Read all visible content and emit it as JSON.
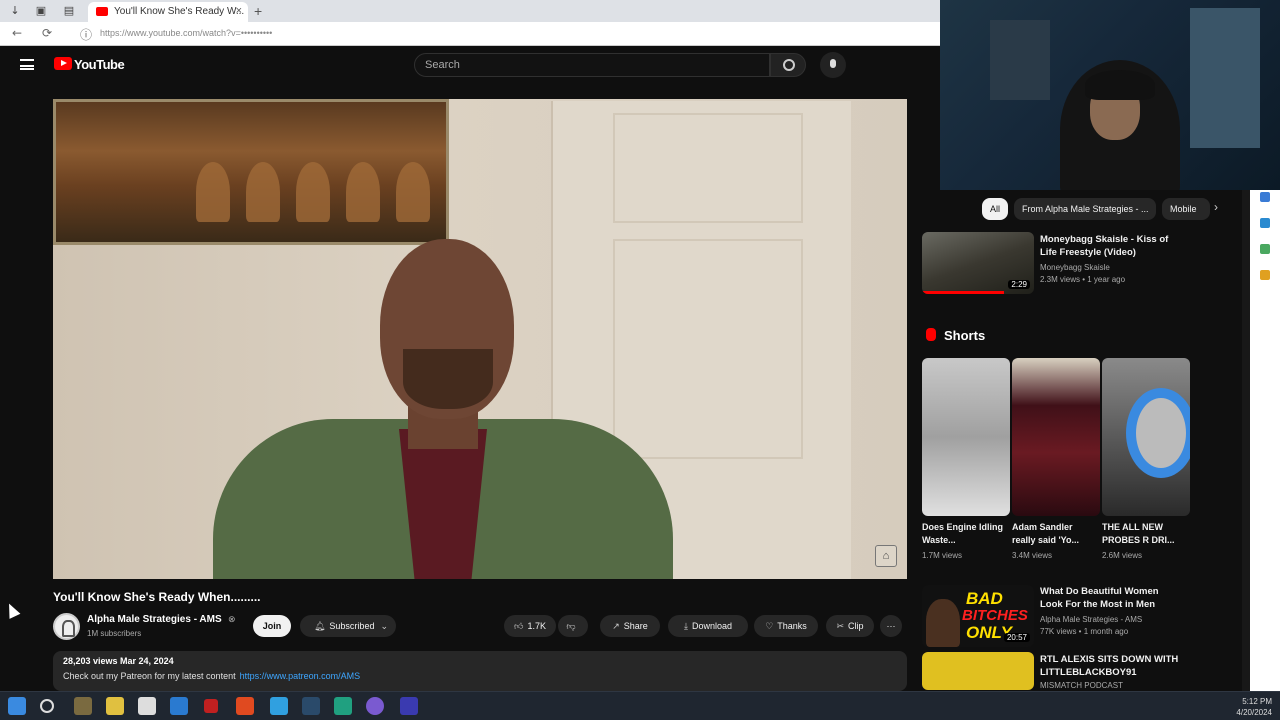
{
  "browser": {
    "tab_title": "You'll Know She's Ready W...",
    "tab_close": "×",
    "new_tab": "+",
    "url": "https://www.youtube.com/watch?v=••••••••••"
  },
  "youtube": {
    "brand": "YouTube",
    "search_placeholder": "Search"
  },
  "video": {
    "title": "You'll Know She's Ready When.........",
    "channel_name": "Alpha Male Strategies - AMS",
    "verified_mark": "⊗",
    "subscribers": "1M subscribers",
    "join_label": "Join",
    "subscribed_label": "Subscribed",
    "likes": "1.7K",
    "share_label": "Share",
    "download_label": "Download",
    "thanks_label": "Thanks",
    "clip_label": "Clip",
    "more_label": "···",
    "stats": "28,203 views  Mar 24, 2024",
    "description": "Check out my Patreon for my latest content",
    "description_link": "https://www.patreon.com/AMS"
  },
  "sidebar": {
    "chips": [
      "All",
      "From Alpha Male Strategies - ...",
      "Mobile"
    ],
    "recommended": [
      {
        "title": "Moneybagg Skaisle - Kiss of Life Freestyle (Video)",
        "channel": "Moneybagg Skaisle",
        "meta": "2.3M views • 1 year ago",
        "duration": "2:29"
      },
      {
        "title": "What Do Beautiful Women Look For the Most in Men",
        "channel": "Alpha Male Strategies - AMS",
        "meta": "77K views • 1 month ago",
        "duration": "20:57"
      },
      {
        "title": "RTL ALEXIS SITS DOWN WITH LITTLEBLACKBOY91",
        "channel": "MISMATCH PODCAST",
        "meta": "",
        "duration": ""
      }
    ],
    "shorts_title": "Shorts",
    "shorts": [
      {
        "title": "Does Engine Idling Waste...",
        "views": "1.7M views"
      },
      {
        "title": "Adam Sandler really said 'Yo...",
        "views": "3.4M views"
      },
      {
        "title": "THE ALL NEW PROBES R DRI...",
        "views": "2.6M views"
      }
    ],
    "rec2_thumb_text": [
      "BAD",
      "BITCHES",
      "ONLY"
    ]
  },
  "taskbar": {
    "time": "5:12 PM",
    "date": "4/20/2024"
  },
  "colors": {
    "accent": "#ff0000",
    "link": "#3ea6ff",
    "background": "#0f0f0f",
    "chip": "#272727"
  }
}
